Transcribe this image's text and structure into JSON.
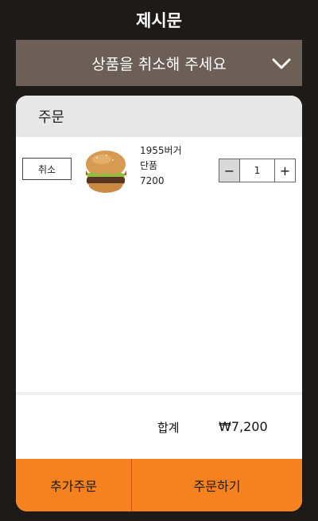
{
  "title": "제시문",
  "prompt": {
    "text": "상품을 취소해 주세요",
    "icon": "chevron-down-icon"
  },
  "order": {
    "header": "주문",
    "items": [
      {
        "cancel_label": "취소",
        "image": "burger-image",
        "name": "1955버거",
        "option": "단품",
        "price": "7200",
        "quantity": "1",
        "minus_label": "−",
        "plus_label": "+"
      }
    ]
  },
  "summary": {
    "total_label": "합계",
    "total_value": "₩7,200"
  },
  "actions": {
    "add_order": "추가주문",
    "place_order": "주문하기"
  },
  "colors": {
    "background": "#1e1a18",
    "prompt_bg": "#6b5f57",
    "accent": "#f5821f",
    "header_bg": "#e7e7e7"
  }
}
